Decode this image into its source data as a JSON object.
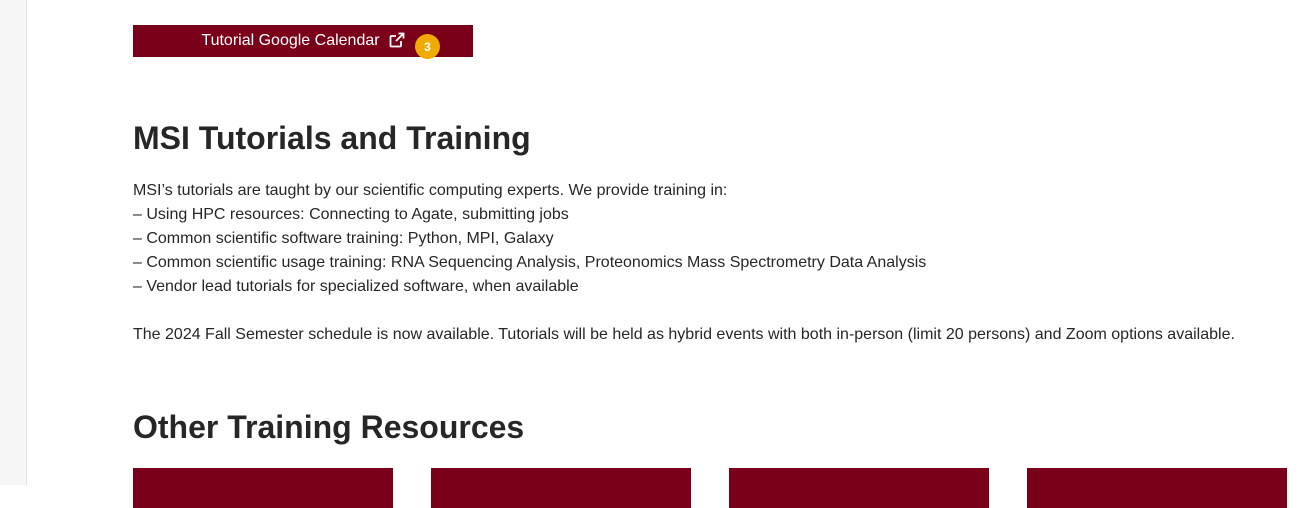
{
  "calendar_button": {
    "label": "Tutorial Google Calendar",
    "icon": "external-link-icon",
    "badge": "3",
    "colors": {
      "background": "#7a0019",
      "text": "#ffffff",
      "badge": "#f0ab00"
    }
  },
  "tutorials_section": {
    "title": "MSI Tutorials and Training",
    "intro": "MSI’s tutorials are taught by our scientific computing experts. We provide training in:",
    "items": [
      "– Using HPC resources: Connecting to Agate, submitting jobs",
      "– Common scientific software training: Python, MPI, Galaxy",
      "– Common scientific usage training: RNA Sequencing Analysis, Proteonomics Mass Spectrometry Data Analysis",
      "– Vendor lead tutorials for specialized software, when available"
    ],
    "schedule": "The 2024 Fall Semester schedule is now available. Tutorials will be held as hybrid events with both in-person (limit 20 persons) and Zoom options available."
  },
  "other_resources": {
    "title": "Other Training Resources",
    "card_color": "#7a0019"
  }
}
